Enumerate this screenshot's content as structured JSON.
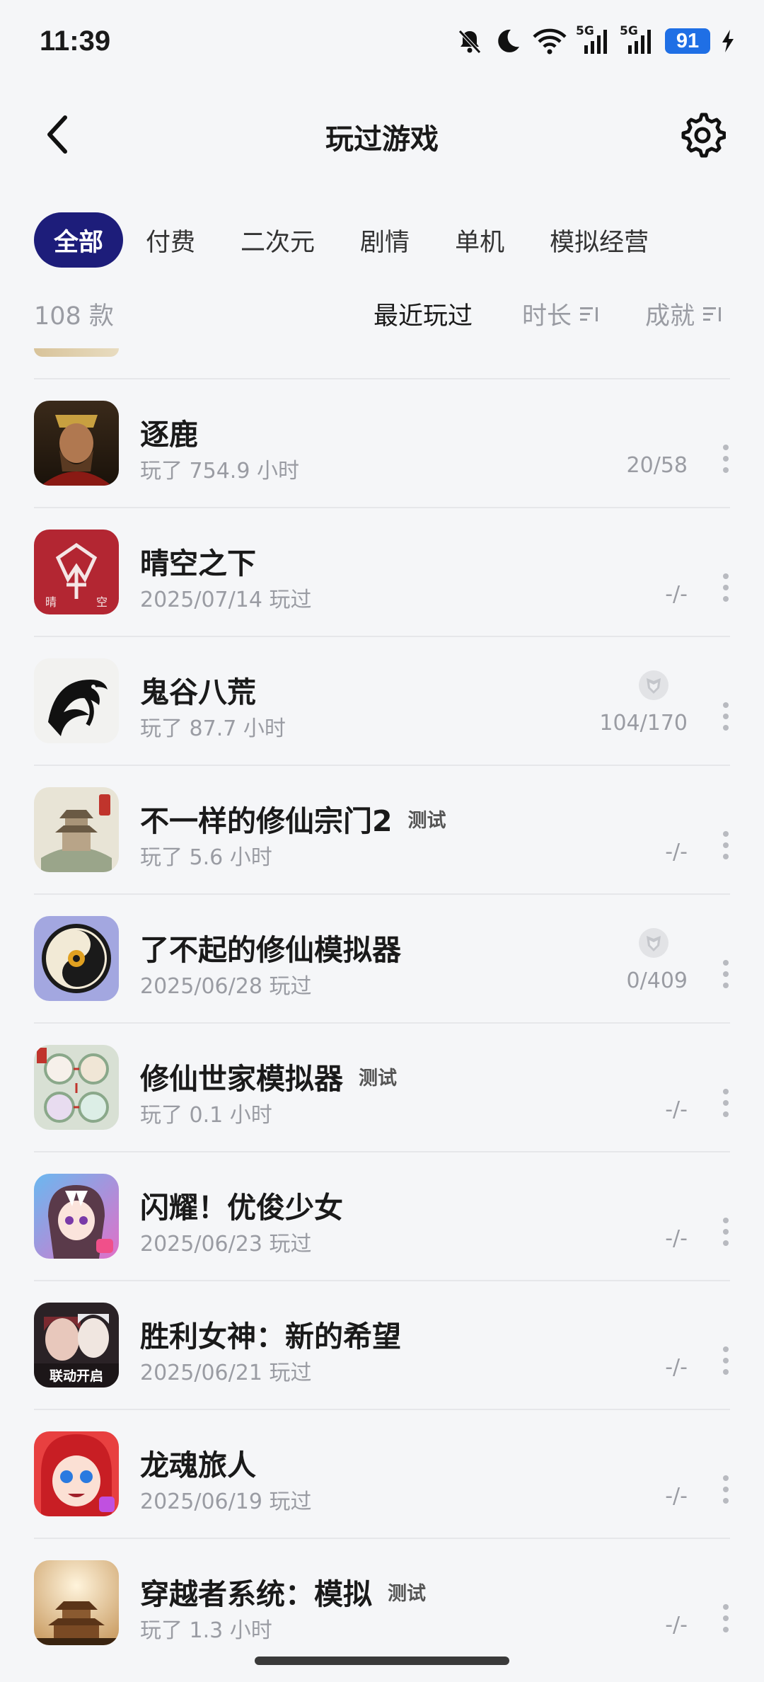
{
  "status_bar": {
    "time": "11:39",
    "net1": "5G",
    "net2": "5G",
    "battery": "91"
  },
  "header": {
    "title": "玩过游戏"
  },
  "tabs": [
    "全部",
    "付费",
    "二次元",
    "剧情",
    "单机",
    "模拟经营"
  ],
  "sort_row": {
    "count": "108 款",
    "sort_recent": "最近玩过",
    "sort_duration": "时长",
    "sort_achievement": "成就"
  },
  "games": [
    {
      "name": "逐鹿",
      "badge": "",
      "sub": "玩了 754.9 小时",
      "achievement": "20/58",
      "trophy": false,
      "icon": "warlord-portrait-icon"
    },
    {
      "name": "晴空之下",
      "badge": "",
      "sub": "2025/07/14 玩过",
      "achievement": "-/-",
      "trophy": false,
      "icon": "red-emblem-icon"
    },
    {
      "name": "鬼谷八荒",
      "badge": "",
      "sub": "玩了 87.7 小时",
      "achievement": "104/170",
      "trophy": true,
      "icon": "ink-dragon-icon"
    },
    {
      "name": "不一样的修仙宗门2",
      "badge": "测试",
      "sub": "玩了 5.6 小时",
      "achievement": "-/-",
      "trophy": false,
      "icon": "sect-pavilion-icon"
    },
    {
      "name": "了不起的修仙模拟器",
      "badge": "",
      "sub": "2025/06/28 玩过",
      "achievement": "0/409",
      "trophy": true,
      "icon": "taiji-swirl-icon"
    },
    {
      "name": "修仙世家模拟器",
      "badge": "测试",
      "sub": "玩了 0.1 小时",
      "achievement": "-/-",
      "trophy": false,
      "icon": "family-portraits-icon"
    },
    {
      "name": "闪耀！优俊少女",
      "badge": "",
      "sub": "2025/06/23 玩过",
      "achievement": "-/-",
      "trophy": false,
      "icon": "anime-horse-girl-icon"
    },
    {
      "name": "胜利女神：新的希望",
      "badge": "",
      "sub": "2025/06/21 玩过",
      "achievement": "-/-",
      "trophy": false,
      "icon": "nikke-characters-icon",
      "icon_text": "联动开启"
    },
    {
      "name": "龙魂旅人",
      "badge": "",
      "sub": "2025/06/19 玩过",
      "achievement": "-/-",
      "trophy": false,
      "icon": "red-hair-girl-icon"
    },
    {
      "name": "穿越者系统：模拟",
      "badge": "测试",
      "sub": "玩了 1.3 小时",
      "achievement": "-/-",
      "trophy": false,
      "icon": "golden-palace-icon"
    }
  ]
}
